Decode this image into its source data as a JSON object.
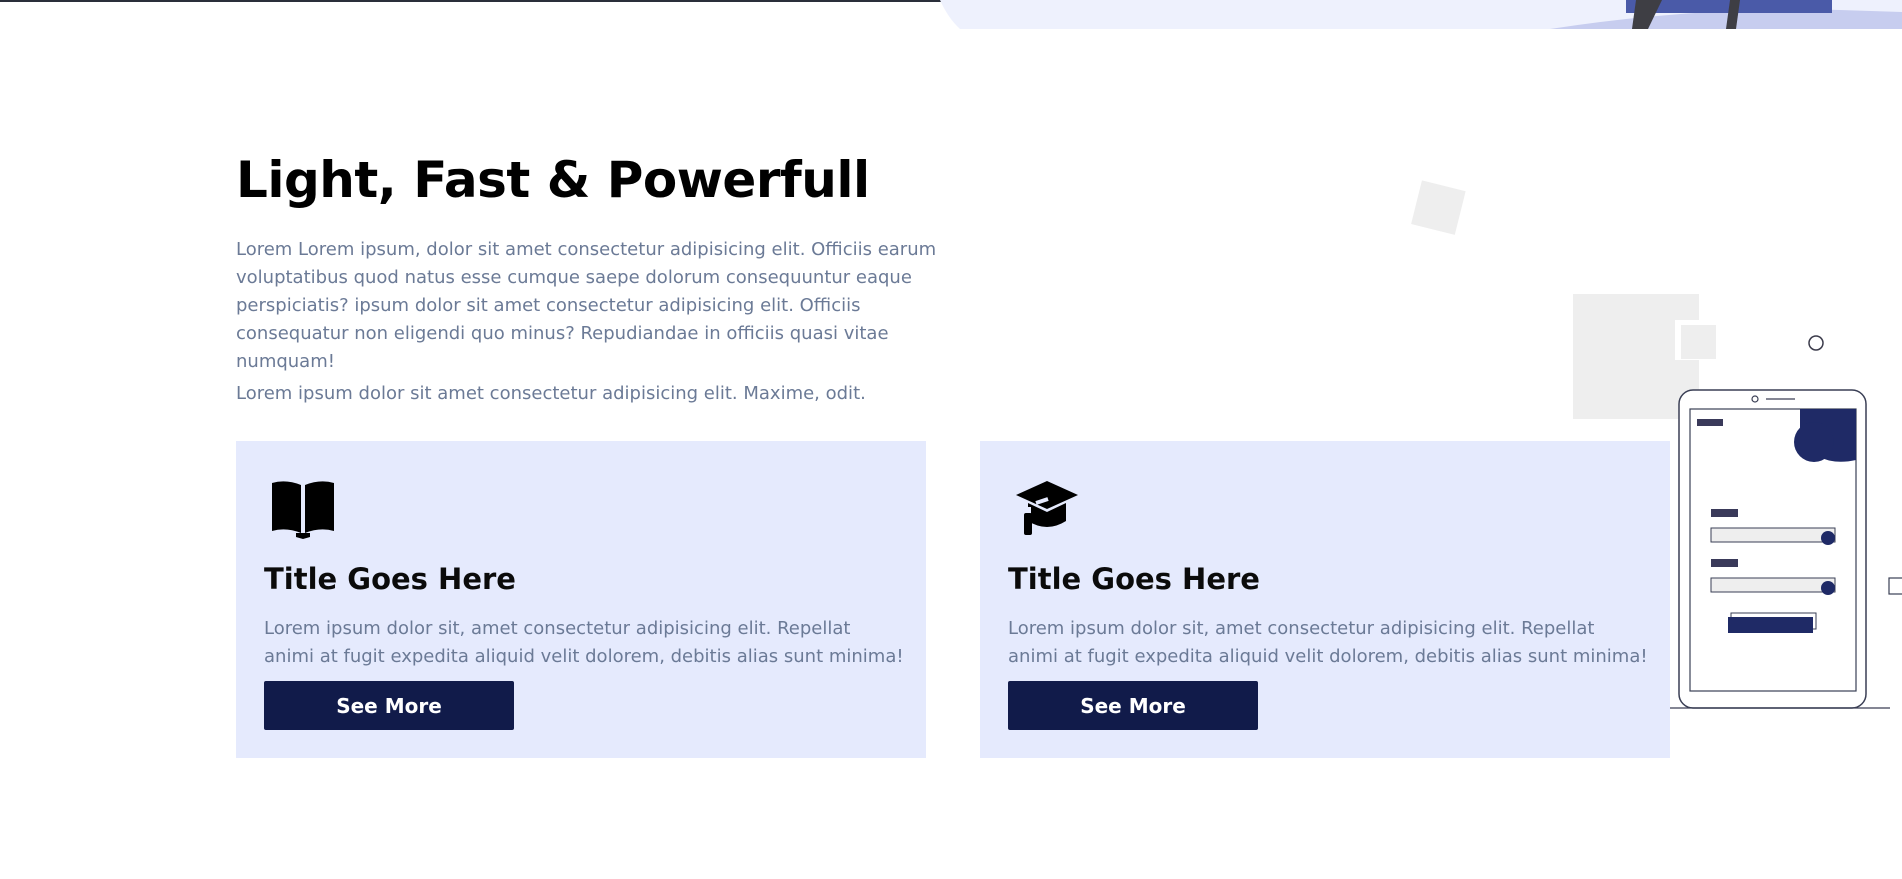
{
  "section": {
    "title": "Light, Fast & Powerfull",
    "intro": "Lorem Lorem ipsum, dolor sit amet consectetur adipisicing elit. Officiis earum voluptatibus quod natus esse cumque saepe dolorum consequuntur eaque perspiciatis? ipsum dolor sit amet consectetur adipisicing elit. Officiis consequatur non eligendi quo minus? Repudiandae in officiis quasi vitae numquam!",
    "intro2": "Lorem ipsum dolor sit amet consectetur adipisicing elit. Maxime, odit."
  },
  "cards": [
    {
      "icon": "book-open-icon",
      "title": "Title Goes Here",
      "text": "Lorem ipsum dolor sit, amet consectetur adipisicing elit. Repellat animi at fugit expedita aliquid velit dolorem, debitis alias sunt minima!",
      "button_label": "See More"
    },
    {
      "icon": "graduation-cap-icon",
      "title": "Title Goes Here",
      "text": "Lorem ipsum dolor sit, amet consectetur adipisicing elit. Repellat animi at fugit expedita aliquid velit dolorem, debitis alias sunt minima!",
      "button_label": "See More"
    }
  ],
  "colors": {
    "card_bg": "#e5eafd",
    "button_bg": "#111b4a",
    "body_text": "#6b7a96",
    "accent_navy": "#1f2a66"
  }
}
